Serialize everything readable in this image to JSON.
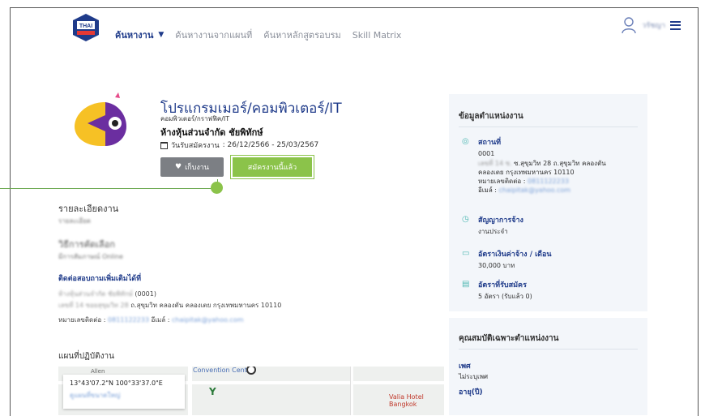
{
  "header": {
    "logo_text": "THAI",
    "nav": {
      "active": "ค้นหางาน",
      "items": [
        "ค้นหางานจากแผนที่",
        "ค้นหาหลักสูตรอบรม",
        "Skill Matrix"
      ]
    },
    "user_name": "วรัชญา"
  },
  "job": {
    "title": "โปรแกรมเมอร์/คอมพิวเตอร์/IT",
    "category": "คอมพิวเตอร์/กราฟฟิค/IT",
    "company": "ห้างหุ้นส่วนจำกัด ชัยพิทักษ์",
    "date_label": "วันรับสมัครงาน",
    "date_range": ": 26/12/2566 - 25/03/2567",
    "save_label": "เก็บงาน",
    "apply_label": "สมัครงานนี้แล้ว"
  },
  "details": {
    "title": "รายละเอียดงาน",
    "body": "รายละเอียด",
    "method_title": "วิธีการคัดเลือก",
    "method_body": "มีการสัมภาษณ์ Online",
    "contact_title": "ติดต่อสอบถามเพิ่มเติมได้ที่",
    "contact_name": "ห้างหุ้นส่วนจำกัด ชัยพิทักษ์",
    "contact_code": "(0001)",
    "contact_addr_blur": "เลขที่ 14 ซอยสุขุมวิท 28",
    "contact_addr": "ถ.สุขุมวิท คลองตัน คลองเตย กรุงเทพมหานคร 10110",
    "phone_label": "หมายเลขติดต่อ :",
    "phone": "0811122233",
    "email_label": "อีเมล์ :",
    "email": "chaipitak@yahoo.com",
    "map_title": "แผนที่ปฏิบัติงาน",
    "map_coords": "13°43'07.2\"N 100°33'37.0\"E",
    "map_sub": "ดูแผนที่ขนาดใหญ่",
    "map_convention": "Convention Centre",
    "map_hotel": "Valia Hotel Bangkok",
    "map_allen": "Allen"
  },
  "info": {
    "title": "ข้อมูลตำแหน่งงาน",
    "location_label": "สถานที่",
    "location_code": "0001",
    "location_blur": "เลขที่ 14 ซ.",
    "location_addr1": "ซ.สุขุมวิท 28 ถ.สุขุมวิท คลองตัน",
    "location_addr2": "คลองเตย กรุงเทพมหานคร 10110",
    "phone_label": "หมายเลขติดต่อ :",
    "phone": "0811122233",
    "email_label": "อีเมล์ :",
    "email": "chaipitak@yahoo.com",
    "contract_label": "สัญญาการจ้าง",
    "contract_val": "งานประจำ",
    "salary_label": "อัตราเงินค่าจ้าง / เดือน",
    "salary_val": "30,000 บาท",
    "positions_label": "อัตราที่รับสมัคร",
    "positions_val": "5 อัตรา (รับแล้ว 0)"
  },
  "qual": {
    "title": "คุณสมบัติเฉพาะตำแหน่งงาน",
    "sex_label": "เพศ",
    "sex_val": "ไม่ระบุเพศ",
    "age_label": "อายุ(ปี)"
  },
  "colors": {
    "brand": "#1f3b8a",
    "apply_green": "#8bc34a",
    "teal_icon": "#4fb8b3"
  }
}
